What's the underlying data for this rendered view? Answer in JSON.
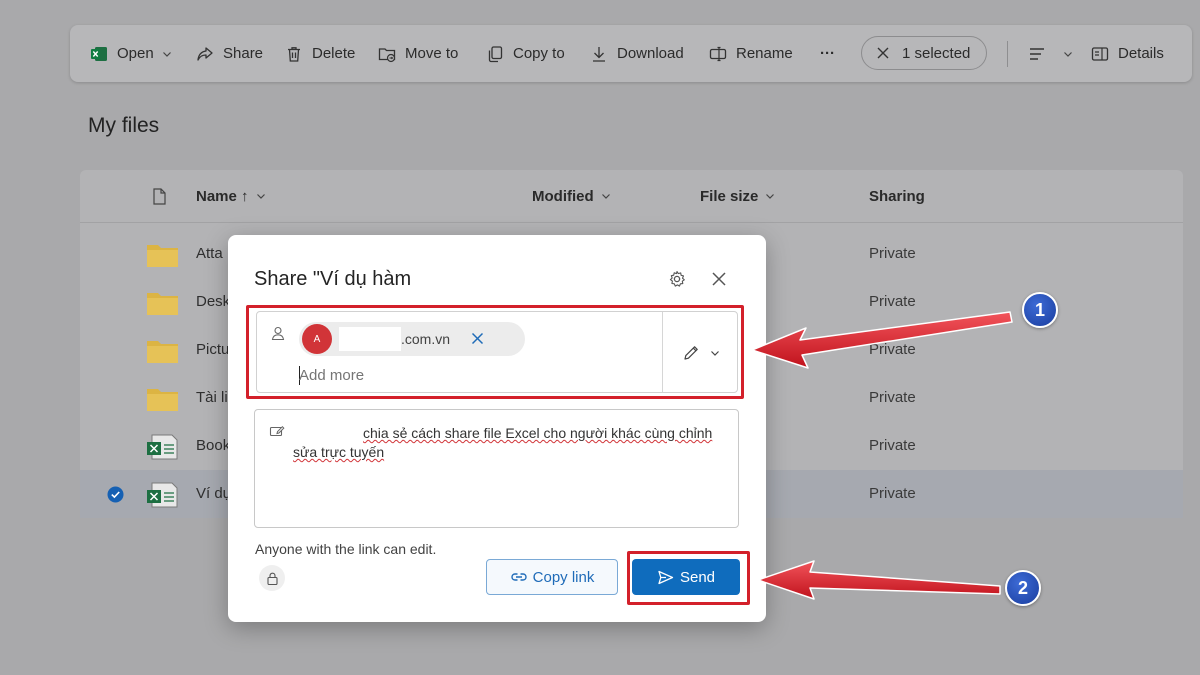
{
  "toolbar": {
    "open": "Open",
    "share": "Share",
    "delete": "Delete",
    "move_to": "Move to",
    "copy_to": "Copy to",
    "download": "Download",
    "rename": "Rename",
    "more": "···",
    "selected": "1 selected",
    "details": "Details"
  },
  "page": {
    "title": "My files"
  },
  "list": {
    "columns": {
      "name": "Name ↑",
      "modified": "Modified",
      "size": "File size",
      "sharing": "Sharing"
    },
    "rows": [
      {
        "name": "Atta",
        "sharing": "Private",
        "type": "folder"
      },
      {
        "name": "Desk",
        "sharing": "Private",
        "type": "folder"
      },
      {
        "name": "Pictu",
        "sharing": "Private",
        "type": "folder"
      },
      {
        "name": "Tài li",
        "sharing": "Private",
        "type": "folder"
      },
      {
        "name": "Book",
        "sharing": "Private",
        "type": "excel"
      },
      {
        "name": "Ví dụ",
        "sharing": "Private",
        "type": "excel",
        "selected": true
      }
    ]
  },
  "dialog": {
    "title": "Share \"Ví dụ hàm",
    "recipient": {
      "avatar_letter": "A",
      "email_suffix": ".com.vn"
    },
    "add_more_placeholder": "Add more",
    "message": "chia sẻ cách share file Excel cho người khác cùng chỉnh sửa trực tuyến",
    "link_info": "Anyone with the link can edit.",
    "copy_link": "Copy link",
    "send": "Send"
  },
  "annotations": {
    "badge_1": "1",
    "badge_2": "2",
    "color": "#d3202a"
  },
  "colors": {
    "accent": "#0f6cbd",
    "avatar": "#d13438",
    "excel_green": "#1d6f42",
    "folder": "#dcb443"
  }
}
